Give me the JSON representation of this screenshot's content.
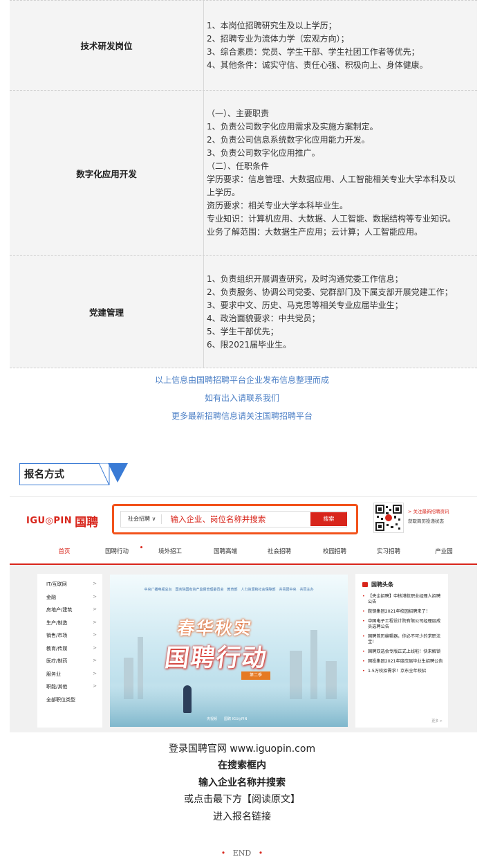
{
  "jobs": [
    {
      "name": "技术研发岗位",
      "lines": [
        "1、本岗位招聘研究生及以上学历；",
        "2、招聘专业为流体力学（宏观方向）；",
        "3、综合素质：党员、学生干部、学生社团工作者等优先；",
        "4、其他条件：诚实守信、责任心强、积极向上、身体健康。"
      ]
    },
    {
      "name": "数字化应用开发",
      "lines": [
        "（一）、主要职责",
        "1、负责公司数字化应用需求及实施方案制定。",
        "2、负责公司信息系统数字化应用能力开发。",
        "3、负责公司数字化应用推广。",
        "（二）、任职条件",
        "学历要求：信息管理、大数据应用、人工智能相关专业大学本科及以",
        "上学历。",
        "资历要求：相关专业大学本科毕业生。",
        "专业知识：计算机应用、大数据、人工智能、数据结构等专业知识。",
        "业务了解范围：大数据生产应用；云计算；人工智能应用。"
      ]
    },
    {
      "name": "党建管理",
      "lines": [
        "1、负责组织开展调查研究，及时沟通党委工作信息；",
        "2、负责服务、协调公司党委、党群部门及下属支部开展党建工作；",
        "3、要求中文、历史、马克思等相关专业应届毕业生；",
        "4、政治面貌要求：中共党员；",
        "5、学生干部优先；",
        "6、限2021届毕业生。"
      ]
    }
  ],
  "notes": [
    "以上信息由国聘招聘平台企业发布信息整理而成",
    "如有出入请联系我们",
    "更多最新招聘信息请关注国聘招聘平台"
  ],
  "section_title": "报名方式",
  "site": {
    "logo_text": "IGU◎PIN",
    "logo_cn": "国聘",
    "search_type": "社会招聘 ∨",
    "search_placeholder": "输入企业、岗位名称并搜索",
    "search_button": "搜索",
    "qr_line1": "> 关注最新招聘资讯",
    "qr_line2": "获取简历投递状态",
    "nav": [
      "首页",
      "国聘行动",
      "境外招工",
      "国聘高端",
      "社会招聘",
      "校园招聘",
      "实习招聘",
      "产业园"
    ],
    "categories": [
      "IT/互联网",
      "金融",
      "房地产/建筑",
      "生产/制造",
      "销售/市场",
      "教育/传媒",
      "医疗/制药",
      "服务业",
      "职能/其他",
      "全部职位类型"
    ],
    "banner_org": "中央广播电视总台　国务院国有资产监督管理委员会　教育部　人力资源和社会保障部　共青团中央　共同主办",
    "banner_title1": "春华秋实",
    "banner_title2": "国聘行动",
    "banner_tag": "第二季",
    "banner_bottom": "央视频　　国聘 IGU◎PIN",
    "news_title": "国聘头条",
    "news": [
      "【央企招聘】中核港航职业经理人招聘公告",
      "鞍钢集团2021年校园招聘来了！",
      "中国电子工程设计院有限公司经理层成员选聘公告",
      "国聘简历编辑器，你必不可少的求职法宝！",
      "国聘双选会专版正式上线啦！快来解锁",
      "国投集团2021年度应届毕业生招聘公告",
      "1.5万校招需求！京东全年校招"
    ],
    "news_more": "更多 >"
  },
  "instructions": [
    "登录国聘官网 www.iguopin.com",
    "在搜索框内",
    "输入企业名称并搜索",
    "或点击最下方【阅读原文】",
    "进入报名链接"
  ],
  "end_text": "END"
}
